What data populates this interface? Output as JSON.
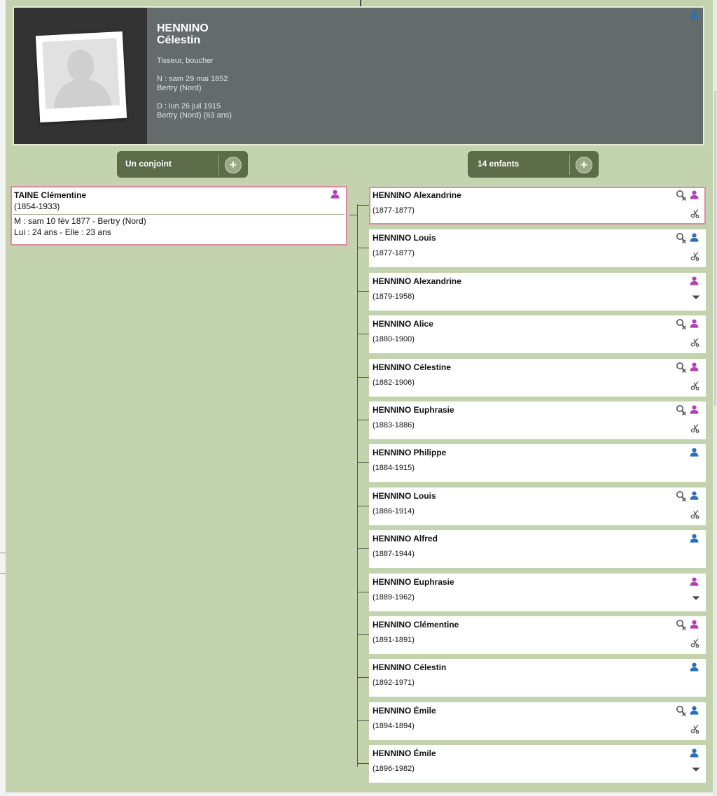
{
  "colors": {
    "background": "#c3d3ad",
    "header_card": "#636b6b",
    "pill_button": "#5d6c48",
    "female_icon": "#b240b6",
    "male_icon": "#2b6fb8",
    "highlight_border": "#e08aa2"
  },
  "person": {
    "surname": "HENNINO",
    "firstname": "Célestin",
    "occupation": "Tisseur, boucher",
    "birth": "N : sam 29 mai 1852",
    "birth_place": "Bertry (Nord)",
    "death": "D : lun 26 juil 1915",
    "death_place": "Bertry (Nord) (63 ans)",
    "icon": "male-person-icon"
  },
  "buttons": {
    "spouses_label": "Un conjoint",
    "children_label": "14 enfants",
    "add_symbol": "+"
  },
  "spouse": {
    "name": "TAINE Clémentine",
    "dates": "(1854-1933)",
    "marriage": "M : sam 10 fév 1877 - Bertry (Nord)",
    "ages": "Lui : 24 ans - Elle : 23 ans",
    "icon": "female-person-icon"
  },
  "children": [
    {
      "name": "HENNINO Alexandrine",
      "dates": "(1877-1877)",
      "sex": "female",
      "link_icon": true,
      "bottom_icon": "scissors-icon",
      "highlighted": true
    },
    {
      "name": "HENNINO Louis",
      "dates": "(1877-1877)",
      "sex": "male",
      "link_icon": true,
      "bottom_icon": "scissors-icon"
    },
    {
      "name": "HENNINO Alexandrine",
      "dates": "(1879-1958)",
      "sex": "female",
      "link_icon": false,
      "bottom_icon": "arrow-down-icon"
    },
    {
      "name": "HENNINO Alice",
      "dates": "(1880-1900)",
      "sex": "female",
      "link_icon": true,
      "bottom_icon": "scissors-icon"
    },
    {
      "name": "HENNINO Célestine",
      "dates": "(1882-1906)",
      "sex": "female",
      "link_icon": true,
      "bottom_icon": "scissors-icon"
    },
    {
      "name": "HENNINO Euphrasie",
      "dates": "(1883-1886)",
      "sex": "female",
      "link_icon": true,
      "bottom_icon": "scissors-icon"
    },
    {
      "name": "HENNINO Philippe",
      "dates": "(1884-1915)",
      "sex": "male",
      "link_icon": false,
      "bottom_icon": ""
    },
    {
      "name": "HENNINO Louis",
      "dates": "(1886-1914)",
      "sex": "male",
      "link_icon": true,
      "bottom_icon": "scissors-icon"
    },
    {
      "name": "HENNINO Alfred",
      "dates": "(1887-1944)",
      "sex": "male",
      "link_icon": false,
      "bottom_icon": ""
    },
    {
      "name": "HENNINO Euphrasie",
      "dates": "(1889-1962)",
      "sex": "female",
      "link_icon": false,
      "bottom_icon": "arrow-down-icon"
    },
    {
      "name": "HENNINO Clémentine",
      "dates": "(1891-1891)",
      "sex": "female",
      "link_icon": true,
      "bottom_icon": "scissors-icon"
    },
    {
      "name": "HENNINO Célestin",
      "dates": "(1892-1971)",
      "sex": "male",
      "link_icon": false,
      "bottom_icon": ""
    },
    {
      "name": "HENNINO Émile",
      "dates": "(1894-1894)",
      "sex": "male",
      "link_icon": true,
      "bottom_icon": "scissors-icon"
    },
    {
      "name": "HENNINO Émile",
      "dates": "(1896-1982)",
      "sex": "male",
      "link_icon": false,
      "bottom_icon": "arrow-down-icon"
    }
  ]
}
